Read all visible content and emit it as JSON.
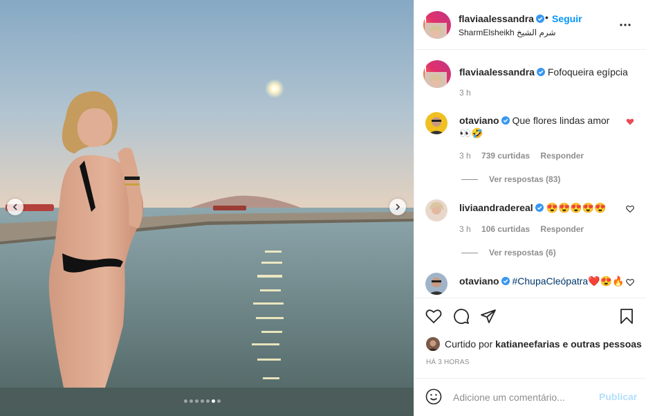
{
  "post": {
    "author": "flaviaalessandra",
    "separator": "•",
    "follow_label": "Seguir",
    "location": "SharmElsheikh شرم الشيخ"
  },
  "caption": {
    "author": "flaviaalessandra",
    "text": "Fofoqueira egípcia",
    "time": "3 h"
  },
  "comments": [
    {
      "author": "otaviano",
      "text": "Que flores lindas amor 👀🤣",
      "time": "3 h",
      "likes": "739 curtidas",
      "reply_label": "Responder",
      "view_replies": "Ver respostas (83)",
      "liked": true
    },
    {
      "author": "liviaandradereal",
      "text": "😍😍😍😍😍",
      "time": "3 h",
      "likes": "106 curtidas",
      "reply_label": "Responder",
      "view_replies": "Ver respostas (6)",
      "liked": false
    },
    {
      "author": "otaviano",
      "hashtag": "#ChupaCleópatra",
      "text": "❤️😍🔥",
      "liked": false
    }
  ],
  "likes": {
    "prefix": "Curtido por",
    "user": "katianeefarias",
    "suffix": "e outras pessoas"
  },
  "timestamp": "HÁ 3 HORAS",
  "composer": {
    "placeholder": "Adicione um comentário...",
    "publish_label": "Publicar"
  },
  "carousel": {
    "total": 7,
    "active_index": 5
  },
  "colors": {
    "accent": "#0095f6",
    "verified": "#3897f0",
    "liked_heart": "#ed4956",
    "publish_disabled": "#b2dffc",
    "muted": "#8e8e8e"
  },
  "icons": [
    "chevron-left-icon",
    "chevron-right-icon",
    "more-icon",
    "verified-icon",
    "heart-icon",
    "comment-icon",
    "share-icon",
    "bookmark-icon",
    "emoji-icon"
  ]
}
